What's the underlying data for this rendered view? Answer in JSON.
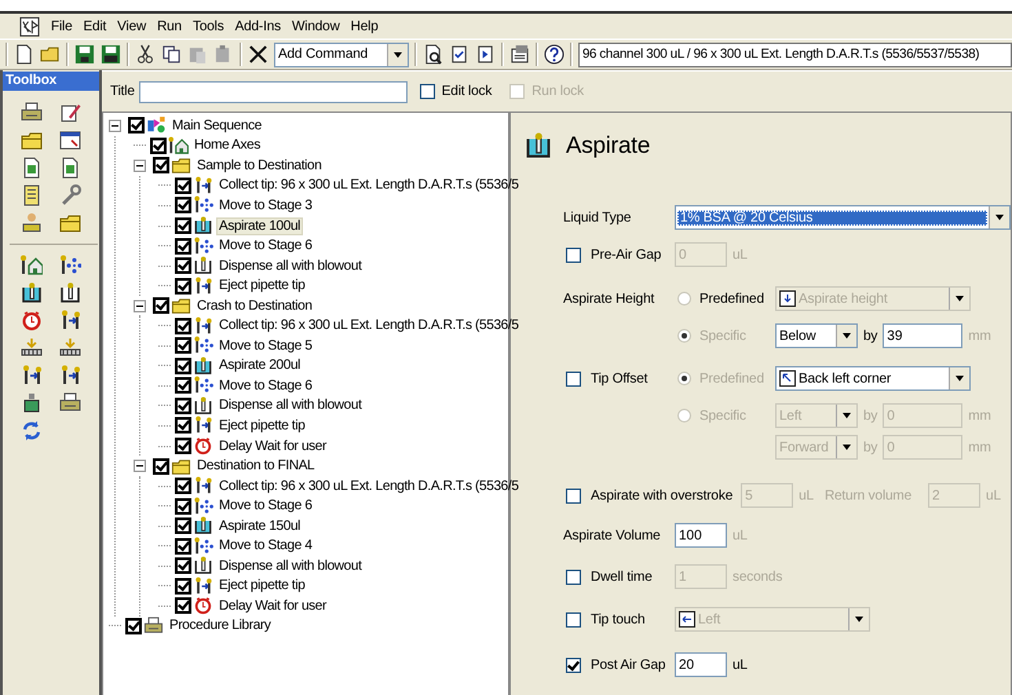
{
  "menu": [
    "File",
    "Edit",
    "View",
    "Run",
    "Tools",
    "Add-Ins",
    "Window",
    "Help"
  ],
  "toolbar": {
    "command": "Add Command",
    "instrument": "96 channel 300 uL / 96 x 300 uL Ext. Length D.A.R.T.s (5536/5537/5538)"
  },
  "toolbox": {
    "title": "Toolbox"
  },
  "title_field": {
    "label": "Title"
  },
  "edit_lock": {
    "label": "Edit lock",
    "checked": false,
    "disabled": false
  },
  "run_lock": {
    "label": "Run lock",
    "checked": false,
    "disabled": true
  },
  "tree": [
    {
      "label": "Main Sequence",
      "kind": "sequence",
      "checked": true,
      "expanded": true,
      "selected": false,
      "children": [
        {
          "label": "Home Axes",
          "kind": "home",
          "checked": true,
          "selected": false
        },
        {
          "label": "Sample to Destination",
          "kind": "group",
          "checked": true,
          "expanded": true,
          "selected": false,
          "children": [
            {
              "label": "Collect tip: 96 x 300 uL Ext. Length D.A.R.T.s (5536/5",
              "kind": "collect",
              "checked": true,
              "selected": false
            },
            {
              "label": "Move to Stage 3",
              "kind": "move",
              "checked": true,
              "selected": false
            },
            {
              "label": "Aspirate 100ul",
              "kind": "aspirate",
              "checked": true,
              "selected": true
            },
            {
              "label": "Move to Stage 6",
              "kind": "move",
              "checked": true,
              "selected": false
            },
            {
              "label": "Dispense all with blowout",
              "kind": "dispense",
              "checked": true,
              "selected": false
            },
            {
              "label": "Eject pipette tip",
              "kind": "eject",
              "checked": true,
              "selected": false
            }
          ]
        },
        {
          "label": "Crash to Destination",
          "kind": "group",
          "checked": true,
          "expanded": true,
          "selected": false,
          "children": [
            {
              "label": "Collect tip: 96 x 300 uL Ext. Length D.A.R.T.s (5536/5",
              "kind": "collect",
              "checked": true,
              "selected": false
            },
            {
              "label": "Move to Stage 5",
              "kind": "move",
              "checked": true,
              "selected": false
            },
            {
              "label": "Aspirate 200ul",
              "kind": "aspirate",
              "checked": true,
              "selected": false
            },
            {
              "label": "Move to Stage 6",
              "kind": "move",
              "checked": true,
              "selected": false
            },
            {
              "label": "Dispense all with blowout",
              "kind": "dispense",
              "checked": true,
              "selected": false
            },
            {
              "label": "Eject pipette tip",
              "kind": "eject",
              "checked": true,
              "selected": false
            },
            {
              "label": "Delay Wait for user",
              "kind": "delay",
              "checked": true,
              "selected": false
            }
          ]
        },
        {
          "label": "Destination to FINAL",
          "kind": "group",
          "checked": true,
          "expanded": true,
          "selected": false,
          "children": [
            {
              "label": "Collect tip: 96 x 300 uL Ext. Length D.A.R.T.s (5536/5",
              "kind": "collect",
              "checked": true,
              "selected": false
            },
            {
              "label": "Move to Stage 6",
              "kind": "move",
              "checked": true,
              "selected": false
            },
            {
              "label": "Aspirate 150ul",
              "kind": "aspirate",
              "checked": true,
              "selected": false
            },
            {
              "label": "Move to Stage 4",
              "kind": "move",
              "checked": true,
              "selected": false
            },
            {
              "label": "Dispense all with blowout",
              "kind": "dispense",
              "checked": true,
              "selected": false
            },
            {
              "label": "Eject pipette tip",
              "kind": "eject",
              "checked": true,
              "selected": false
            },
            {
              "label": "Delay Wait for user",
              "kind": "delay",
              "checked": true,
              "selected": false
            }
          ]
        }
      ]
    },
    {
      "label": "Procedure Library",
      "kind": "library",
      "checked": true,
      "selected": false
    }
  ],
  "step": {
    "title": "Aspirate",
    "kind": "aspirate"
  },
  "liquid_type": {
    "label": "Liquid Type",
    "value": "1% BSA @ 20 Celsius"
  },
  "pre_air_gap": {
    "label": "Pre-Air Gap",
    "checked": false,
    "value": "0",
    "unit": "uL"
  },
  "aspirate_height": {
    "label": "Aspirate Height",
    "options": [
      {
        "label": "Predefined",
        "selected": false,
        "disabled": false
      },
      {
        "label": "Specific",
        "selected": true,
        "disabled": true
      }
    ],
    "predefined_value": "Aspirate height",
    "offsets": [
      {
        "direction": "Below",
        "by": "by",
        "value": "39",
        "unit": "mm"
      }
    ]
  },
  "tip_offset": {
    "label": "Tip Offset",
    "checked": false,
    "options": [
      {
        "label": "Predefined",
        "selected": true,
        "disabled": true
      },
      {
        "label": "Specific",
        "selected": false,
        "disabled": true
      }
    ],
    "predefined_value": "Back left corner",
    "offsets": [
      {
        "direction": "Left",
        "by": "by",
        "value": "0",
        "unit": "mm"
      },
      {
        "direction": "Forward",
        "by": "by",
        "value": "0",
        "unit": "mm"
      }
    ]
  },
  "overstroke": {
    "label": "Aspirate with overstroke",
    "checked": false,
    "value": "5",
    "unit": "uL",
    "return_label": "Return volume",
    "return_value": "2",
    "return_unit": "uL"
  },
  "aspirate_volume": {
    "label": "Aspirate Volume",
    "value": "100",
    "unit": "uL"
  },
  "dwell_time": {
    "label": "Dwell time",
    "checked": false,
    "value": "1",
    "unit": "seconds"
  },
  "tip_touch": {
    "label": "Tip touch",
    "checked": false,
    "value": "Left"
  },
  "post_air_gap": {
    "label": "Post Air Gap",
    "checked": true,
    "value": "20",
    "unit": "uL"
  }
}
